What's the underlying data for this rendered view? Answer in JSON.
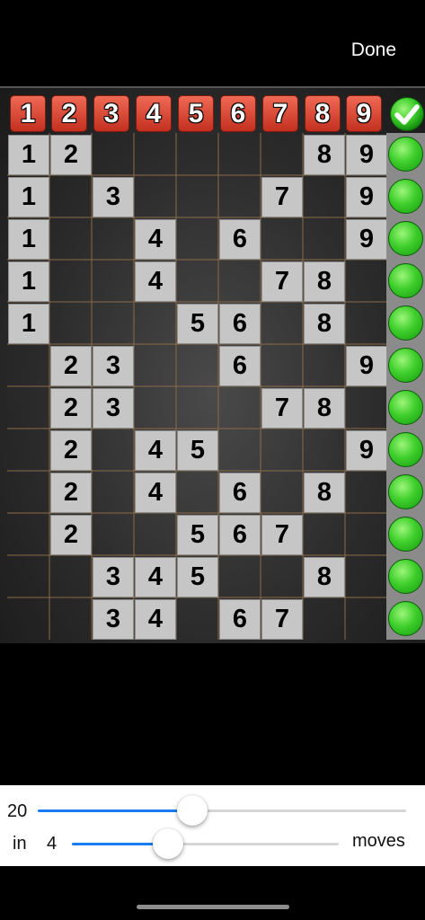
{
  "nav": {
    "done_label": "Done"
  },
  "board": {
    "headers": [
      "1",
      "2",
      "3",
      "4",
      "5",
      "6",
      "7",
      "8",
      "9"
    ],
    "rows": [
      [
        "1",
        "2",
        "",
        "",
        "",
        "",
        "",
        "8",
        "9"
      ],
      [
        "1",
        "",
        "3",
        "",
        "",
        "",
        "7",
        "",
        "9"
      ],
      [
        "1",
        "",
        "",
        "4",
        "",
        "6",
        "",
        "",
        "9"
      ],
      [
        "1",
        "",
        "",
        "4",
        "",
        "",
        "7",
        "8",
        ""
      ],
      [
        "1",
        "",
        "",
        "",
        "5",
        "6",
        "",
        "8",
        ""
      ],
      [
        "",
        "2",
        "3",
        "",
        "",
        "6",
        "",
        "",
        "9"
      ],
      [
        "",
        "2",
        "3",
        "",
        "",
        "",
        "7",
        "8",
        ""
      ],
      [
        "",
        "2",
        "",
        "4",
        "5",
        "",
        "",
        "",
        "9"
      ],
      [
        "",
        "2",
        "",
        "4",
        "",
        "6",
        "",
        "8",
        ""
      ],
      [
        "",
        "2",
        "",
        "",
        "5",
        "6",
        "7",
        "",
        ""
      ],
      [
        "",
        "",
        "3",
        "4",
        "5",
        "",
        "",
        "8",
        ""
      ],
      [
        "",
        "",
        "3",
        "4",
        "",
        "6",
        "7",
        "",
        ""
      ]
    ],
    "row_status": [
      "ok",
      "ok",
      "ok",
      "ok",
      "ok",
      "ok",
      "ok",
      "ok",
      "ok",
      "ok",
      "ok",
      "ok"
    ],
    "header_status_icon": "checkmark-icon"
  },
  "controls": {
    "count_value": "20",
    "count_slider_fraction": 0.42,
    "in_label": "in",
    "moves_value": "4",
    "moves_slider_fraction": 0.36,
    "moves_label": "moves",
    "accent_color": "#1a7cf0"
  }
}
